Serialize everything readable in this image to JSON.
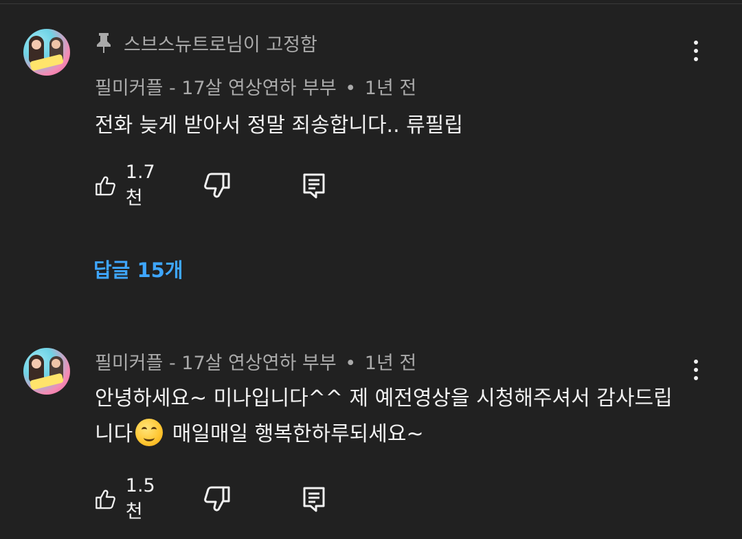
{
  "comments": [
    {
      "pinned_by": "스브스뉴트로님이 고정함",
      "author": "필미커플 - 17살 연상연하 부부",
      "dot": "•",
      "time": "1년 전",
      "text_lines": [
        "전화 늦게 받아서 정말 죄송합니다.. 류필립"
      ],
      "likes": "1.7천",
      "replies": "답글 15개"
    },
    {
      "author": "필미커플 - 17살 연상연하 부부",
      "dot": "•",
      "time": "1년 전",
      "text_line1": "안녕하세요~ 미나입니다^^ 제 예전영상을 시청해주셔서 감사드립",
      "text_line2_a": "니다",
      "text_line2_b": " 매일매일 행복한하루되세요~",
      "emoji": "smiling-face",
      "likes": "1.5천"
    }
  ],
  "colors": {
    "background": "#212121",
    "text": "#f1f1f1",
    "secondary": "#aaaaaa",
    "link": "#3ea6ff"
  }
}
